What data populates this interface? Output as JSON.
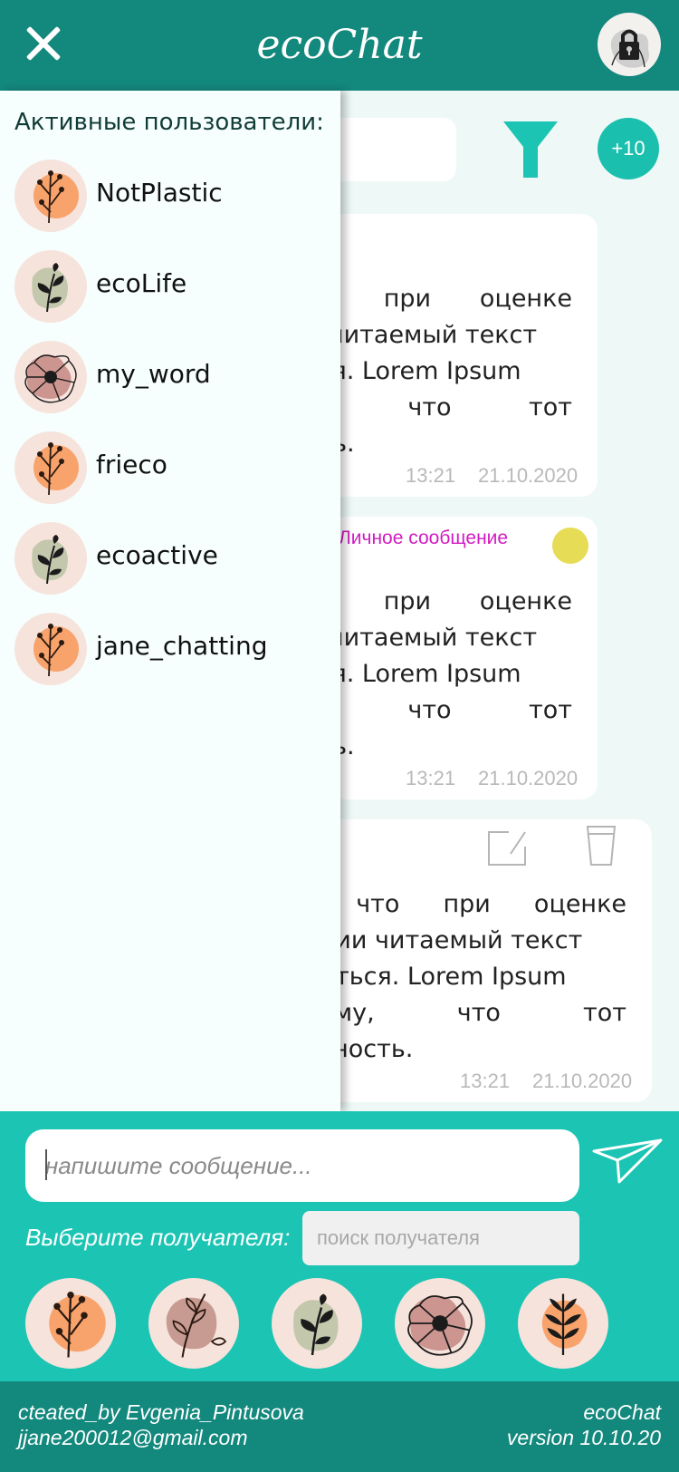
{
  "header": {
    "title": "ecoChat",
    "close_icon": "close-icon",
    "profile_icon": "lock-avatar-icon"
  },
  "toolbar": {
    "filter_icon": "filter-icon",
    "count_badge": "+10"
  },
  "messages": [
    {
      "lines": [
        "нто при оценке",
        "ии читаемый текст",
        "ться. Lorem Ipsum",
        "му, что тот",
        "ость."
      ],
      "time": "13:21",
      "date": "21.10.2020"
    },
    {
      "private_label": "Личное сообщение",
      "lines": [
        "нто при оценке",
        "ии читаемый текст",
        "ться. Lorem Ipsum",
        "му, что тот",
        "ость."
      ],
      "time": "13:21",
      "date": "21.10.2020",
      "dot_color": "#e6dc55"
    },
    {
      "lines": [
        "о, что при оценке",
        "зиции читаемый текст",
        "очиться. Lorem Ipsum",
        "отому, что тот",
        "остность."
      ],
      "time": "13:21",
      "date": "21.10.2020",
      "edit_icon": "edit-icon",
      "delete_icon": "cup-delete-icon"
    }
  ],
  "sidebar": {
    "title": "Активные пользователи:",
    "users": [
      {
        "name": "NotPlastic",
        "avatar": "orange-flower-avatar"
      },
      {
        "name": "ecoLife",
        "avatar": "leaf-avatar"
      },
      {
        "name": "my_word",
        "avatar": "pink-poppy-avatar"
      },
      {
        "name": "frieco",
        "avatar": "orange-flower-avatar"
      },
      {
        "name": "ecoactive",
        "avatar": "leaf-avatar"
      },
      {
        "name": "jane_chatting",
        "avatar": "orange-flower-avatar"
      }
    ]
  },
  "composer": {
    "message_placeholder": "напишите сообщение...",
    "send_icon": "send-icon",
    "recipient_label": "Выберите получателя:",
    "recipient_placeholder": "поиск получателя",
    "recipients": [
      "orange-flower-avatar",
      "pink-branch-avatar",
      "leaf-avatar",
      "pink-poppy-avatar",
      "black-branch-avatar"
    ]
  },
  "footer": {
    "author": "cteated_by Evgenia_Pintusova",
    "email": "jjane200012@gmail.com",
    "app_name": "ecoChat",
    "version": "version 10.10.20"
  },
  "colors": {
    "header": "#13887d",
    "accent": "#1bc4b3",
    "background": "#eef9f7",
    "private": "#d21bc1"
  }
}
